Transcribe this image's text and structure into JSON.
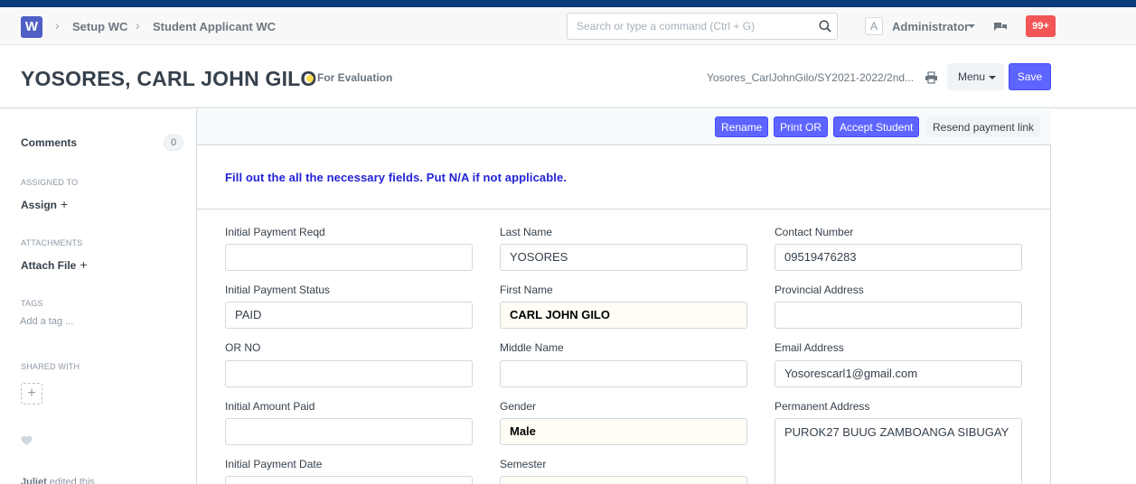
{
  "navbar": {
    "logo_letter": "W",
    "breadcrumbs": [
      "Setup WC",
      "Student Applicant WC"
    ],
    "search_placeholder": "Search or type a command (Ctrl + G)",
    "avatar_letter": "A",
    "user_name": "Administrator",
    "notification_count": "99+"
  },
  "header": {
    "title": "YOSORES, CARL JOHN GILO",
    "status": "For Evaluation",
    "doc_name": "Yosores_CarlJohnGilo/SY2021-2022/2nd...",
    "menu_label": "Menu",
    "save_label": "Save"
  },
  "sidebar": {
    "comments_label": "Comments",
    "comments_count": "0",
    "assigned_to_label": "ASSIGNED TO",
    "assign_label": "Assign",
    "attachments_label": "ATTACHMENTS",
    "attach_label": "Attach File",
    "tags_label": "TAGS",
    "add_tag_label": "Add a tag ...",
    "shared_with_label": "SHARED WITH",
    "plus_symbol": "+",
    "edit_user": "Juliet",
    "edit_text": " edited this"
  },
  "toolbar": {
    "buttons": [
      "Rename",
      "Print OR",
      "Accept Student",
      "Resend payment link"
    ]
  },
  "intro_text": "Fill out the all the necessary fields. Put N/A if not applicable.",
  "fields": {
    "col1": [
      {
        "label": "Initial Payment Reqd",
        "value": ""
      },
      {
        "label": "Initial Payment Status",
        "value": "PAID"
      },
      {
        "label": "OR NO",
        "value": ""
      },
      {
        "label": "Initial Amount Paid",
        "value": ""
      },
      {
        "label": "Initial Payment Date",
        "value": ""
      }
    ],
    "col2": [
      {
        "label": "Last Name",
        "value": "YOSORES"
      },
      {
        "label": "First Name",
        "value": "CARL JOHN GILO"
      },
      {
        "label": "Middle Name",
        "value": ""
      },
      {
        "label": "Gender",
        "value": "Male"
      },
      {
        "label": "Semester",
        "value": ""
      }
    ],
    "col3": [
      {
        "label": "Contact Number",
        "value": "09519476283"
      },
      {
        "label": "Provincial Address",
        "value": ""
      },
      {
        "label": "Email Address",
        "value": "Yosorescarl1@gmail.com"
      },
      {
        "label": "Permanent Address",
        "value": "PUROK27 BUUG ZAMBOANGA SIBUGAY"
      }
    ]
  }
}
